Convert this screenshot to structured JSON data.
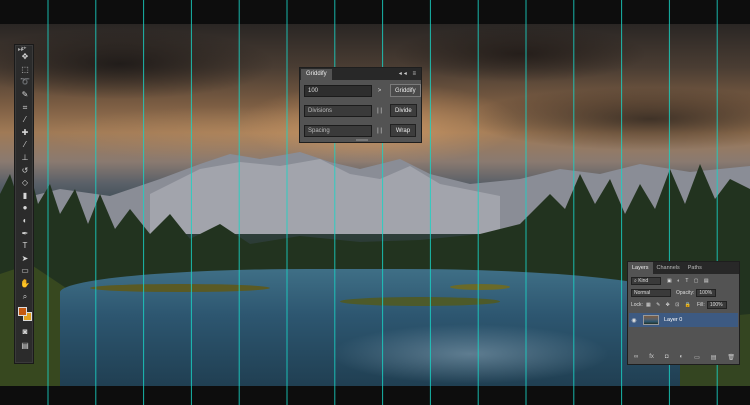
{
  "griddify": {
    "tab": "Griddify",
    "controls": "◂◂ ≡",
    "value": "100",
    "arrow": ">",
    "griddify_button": "Griddify",
    "divisions_placeholder": "Divisions",
    "divisions_sep": "| |",
    "divide_button": "Divide",
    "spacing_placeholder": "Spacing",
    "spacing_sep": "| |",
    "wrap_button": "Wrap"
  },
  "layers": {
    "tabs": [
      "Layers",
      "Channels",
      "Paths"
    ],
    "kind": "Kind",
    "blend_mode": "Normal",
    "opacity_label": "Opacity:",
    "opacity": "100%",
    "lock_label": "Lock:",
    "fill_label": "Fill:",
    "fill": "100%",
    "layer_name": "Layer 0",
    "bottom_icons": [
      "∞",
      "fx",
      "◘",
      "◐",
      "▭",
      "▤",
      "🗑"
    ]
  },
  "colors": {
    "foreground": "#c45a12",
    "background": "#e0a020",
    "guide": "#19d3c5"
  },
  "tools": [
    "move-tool-icon",
    "marquee-tool-icon",
    "lasso-tool-icon",
    "quick-select-tool-icon",
    "crop-tool-icon",
    "eyedropper-tool-icon",
    "healing-brush-icon",
    "brush-tool-icon",
    "clone-stamp-icon",
    "history-brush-icon",
    "eraser-tool-icon",
    "gradient-tool-icon",
    "blur-tool-icon",
    "dodge-tool-icon",
    "pen-tool-icon",
    "type-tool-icon",
    "path-select-icon",
    "rectangle-tool-icon",
    "hand-tool-icon",
    "zoom-tool-icon"
  ]
}
